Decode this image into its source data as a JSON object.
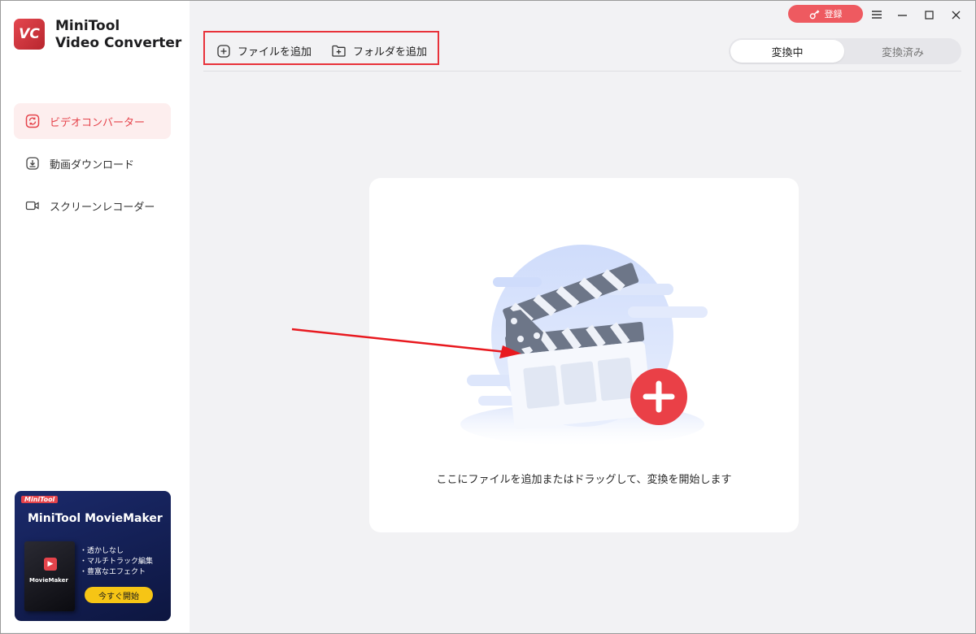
{
  "app": {
    "logo_text": "VC",
    "title_line1": "MiniTool",
    "title_line2": "Video Converter"
  },
  "sidebar": {
    "items": [
      {
        "label": "ビデオコンバーター",
        "icon": "convert-icon",
        "active": true
      },
      {
        "label": "動画ダウンロード",
        "icon": "download-icon",
        "active": false
      },
      {
        "label": "スクリーンレコーダー",
        "icon": "camera-icon",
        "active": false
      }
    ]
  },
  "promo": {
    "brand": "MiniTool",
    "title": "MiniTool MovieMaker",
    "box_name": "MovieMaker",
    "features": [
      "・透かしなし",
      "・マルチトラック編集",
      "・豊富なエフェクト"
    ],
    "cta": "今すぐ開始"
  },
  "header": {
    "register_label": "登録"
  },
  "toolbar": {
    "add_file": "ファイルを追加",
    "add_folder": "フォルダを追加"
  },
  "tabs": {
    "converting": "変換中",
    "converted": "変換済み"
  },
  "dropzone": {
    "hint": "ここにファイルを追加またはドラッグして、変換を開始します"
  },
  "colors": {
    "accent": "#e5434b",
    "highlight_border": "#e8323a"
  }
}
